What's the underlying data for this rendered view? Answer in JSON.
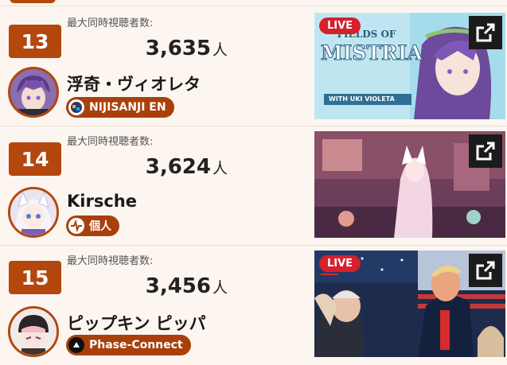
{
  "rows": [
    {
      "rank": "13",
      "peak_label": "最大同時視聴者数:",
      "peak_value": "3,635",
      "unit": "人",
      "name": "浮奇・ヴィオレタ",
      "badge": "NIJISANJI EN",
      "live": "LIVE",
      "thumb_text": [
        "FIELDS OF",
        "MISTRIA",
        "WITH UKI VIOLETA"
      ]
    },
    {
      "rank": "14",
      "peak_label": "最大同時視聴者数:",
      "peak_value": "3,624",
      "unit": "人",
      "name": "Kirsche",
      "badge": "個人",
      "live": ""
    },
    {
      "rank": "15",
      "peak_label": "最大同時視聴者数:",
      "peak_value": "3,456",
      "unit": "人",
      "name": "ピップキン ピッパ",
      "badge": "Phase-Connect",
      "live": "LIVE"
    }
  ],
  "colors": {
    "accent": "#b3470e",
    "live": "#d6202c",
    "background": "#fdf6f0"
  },
  "icons": [
    "external-link-icon",
    "heartbeat-icon",
    "nijisanji-logo-icon",
    "phase-connect-logo-icon"
  ]
}
